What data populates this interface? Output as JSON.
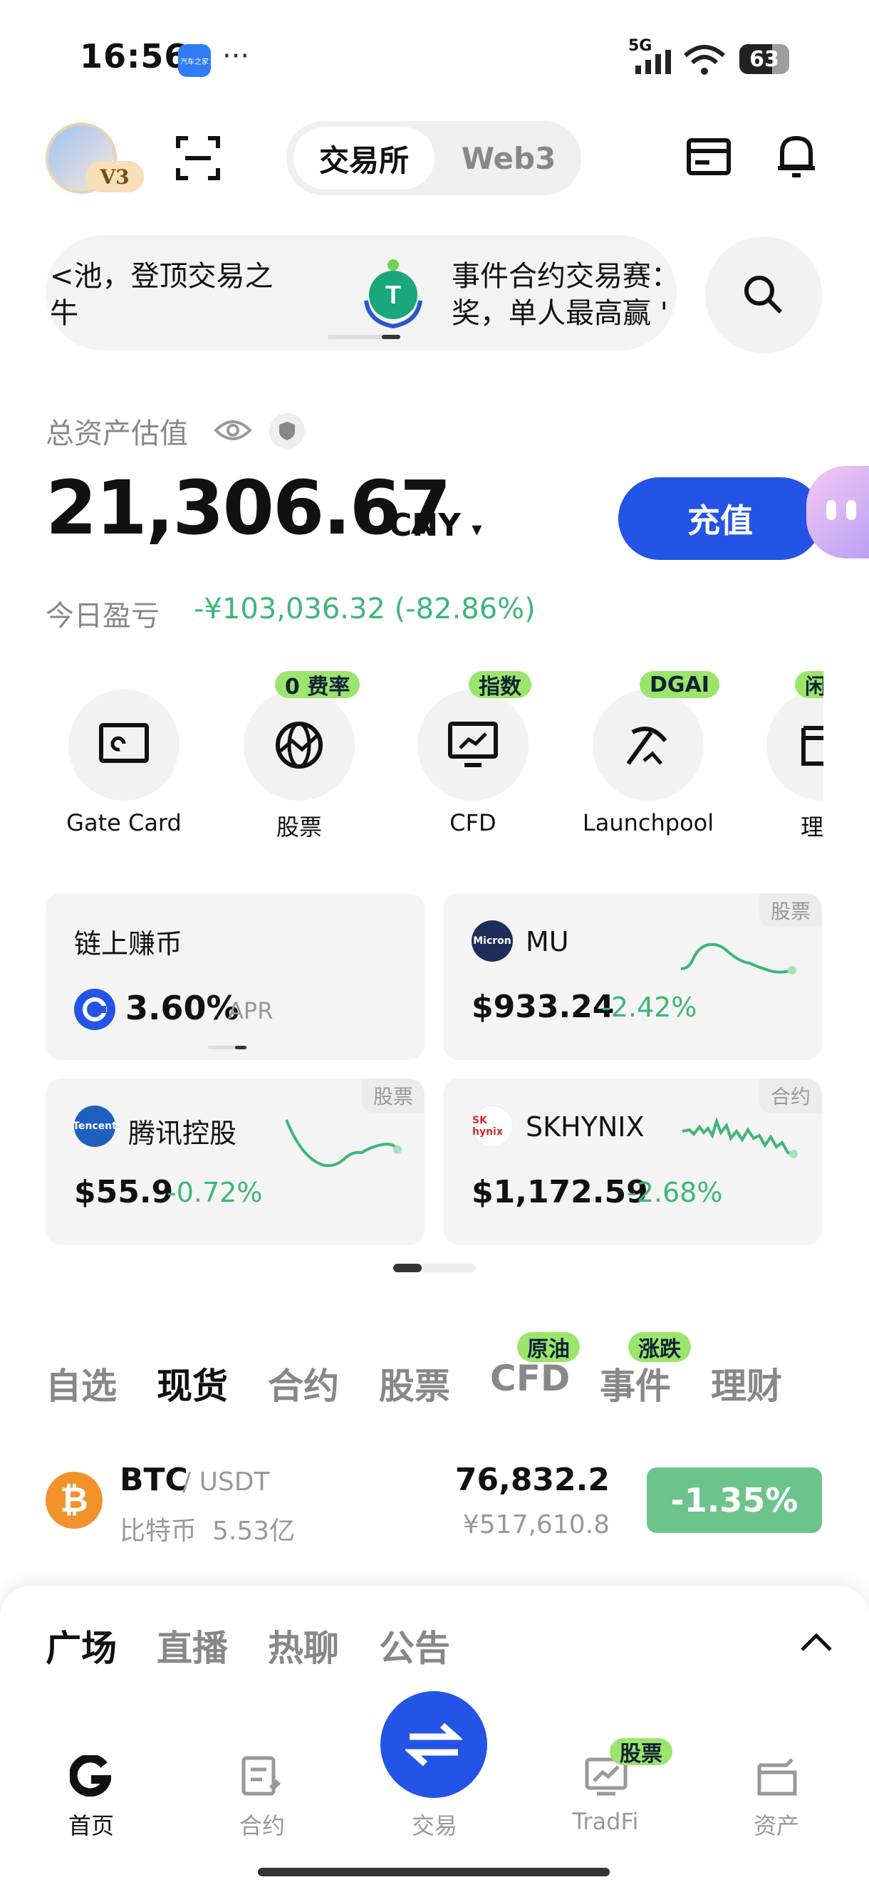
{
  "status_bar": {
    "time": "16:56",
    "app_label": "汽车之家",
    "more": "···",
    "network": "5G",
    "battery": "63"
  },
  "header": {
    "vip": "V3",
    "tabs": [
      {
        "label": "交易所"
      },
      {
        "label": "Web3"
      }
    ]
  },
  "banner": {
    "left_line1": "<池，登顶交易之",
    "left_line2": "牛",
    "right_line1": "事件合约交易赛：",
    "right_line2": "奖，单人最高赢 '"
  },
  "assets": {
    "label": "总资产估值",
    "value": "21,306.67",
    "currency": "CNY",
    "deposit": "充值",
    "pnl_label": "今日盈亏",
    "pnl_value": "-¥103,036.32 (-82.86%)"
  },
  "features": [
    {
      "label": "Gate Card",
      "badge": "",
      "icon": "card-icon"
    },
    {
      "label": "股票",
      "badge": "0 费率",
      "icon": "globe-icon"
    },
    {
      "label": "CFD",
      "badge": "指数",
      "icon": "monitor-chart-icon"
    },
    {
      "label": "Launchpool",
      "badge": "DGAI",
      "icon": "pickaxe-icon"
    },
    {
      "label": "理",
      "badge": "闲",
      "icon": "wallet-icon"
    }
  ],
  "cards": [
    {
      "title": "链上赚币",
      "value": "3.60%",
      "unit": "APR"
    },
    {
      "tag": "股票",
      "name": "MU",
      "logo": "Micron",
      "price": "$933.24",
      "change": "-2.42%"
    },
    {
      "tag": "股票",
      "name": "腾讯控股",
      "logo": "Tencent",
      "price": "$55.9",
      "change": "-0.72%"
    },
    {
      "tag": "合约",
      "name": "SKHYNIX",
      "logo": "SK hynix",
      "price": "$1,172.59",
      "change": "-2.68%"
    }
  ],
  "market_tabs": [
    {
      "label": "自选",
      "badge": ""
    },
    {
      "label": "现货",
      "badge": ""
    },
    {
      "label": "合约",
      "badge": ""
    },
    {
      "label": "股票",
      "badge": ""
    },
    {
      "label": "CFD",
      "badge": "原油"
    },
    {
      "label": "事件",
      "badge": "涨跌"
    },
    {
      "label": "理财",
      "badge": ""
    }
  ],
  "ticker": {
    "symbol": "BTC",
    "quote": "/ USDT",
    "name": "比特币",
    "volume": "5.53亿",
    "price": "76,832.2",
    "price_cny": "¥517,610.8",
    "change": "-1.35%"
  },
  "sheet_tabs": [
    {
      "label": "广场"
    },
    {
      "label": "直播"
    },
    {
      "label": "热聊"
    },
    {
      "label": "公告"
    }
  ],
  "bottom_nav": [
    {
      "label": "首页",
      "badge": ""
    },
    {
      "label": "合约",
      "badge": ""
    },
    {
      "label": "交易",
      "badge": ""
    },
    {
      "label": "TradFi",
      "badge": "股票"
    },
    {
      "label": "资产",
      "badge": ""
    }
  ],
  "colors": {
    "accent": "#2354e6",
    "down": "#3fb57a",
    "badge": "#9be56d"
  }
}
